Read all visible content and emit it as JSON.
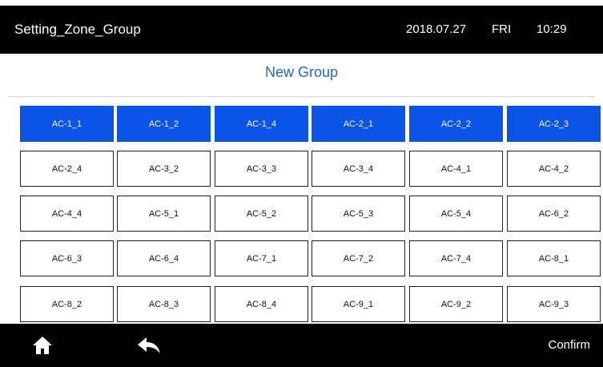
{
  "header": {
    "title": "Setting_Zone_Group",
    "date": "2018.07.27",
    "day": "FRI",
    "time": "10:29"
  },
  "subtitle": "New Group",
  "colors": {
    "selected": "#0a55e8",
    "accent_text": "#1f66e0",
    "bar": "#000000"
  },
  "grid": {
    "rows": [
      [
        {
          "label": "AC-1_1",
          "selected": true
        },
        {
          "label": "AC-1_2",
          "selected": true
        },
        {
          "label": "AC-1_4",
          "selected": true
        },
        {
          "label": "AC-2_1",
          "selected": true
        },
        {
          "label": "AC-2_2",
          "selected": true
        },
        {
          "label": "AC-2_3",
          "selected": true
        }
      ],
      [
        {
          "label": "AC-2_4",
          "selected": false
        },
        {
          "label": "AC-3_2",
          "selected": false
        },
        {
          "label": "AC-3_3",
          "selected": false
        },
        {
          "label": "AC-3_4",
          "selected": false
        },
        {
          "label": "AC-4_1",
          "selected": false
        },
        {
          "label": "AC-4_2",
          "selected": false
        }
      ],
      [
        {
          "label": "AC-4_4",
          "selected": false
        },
        {
          "label": "AC-5_1",
          "selected": false
        },
        {
          "label": "AC-5_2",
          "selected": false
        },
        {
          "label": "AC-5_3",
          "selected": false
        },
        {
          "label": "AC-5_4",
          "selected": false
        },
        {
          "label": "AC-6_2",
          "selected": false
        }
      ],
      [
        {
          "label": "AC-6_3",
          "selected": false
        },
        {
          "label": "AC-6_4",
          "selected": false
        },
        {
          "label": "AC-7_1",
          "selected": false
        },
        {
          "label": "AC-7_2",
          "selected": false
        },
        {
          "label": "AC-7_4",
          "selected": false
        },
        {
          "label": "AC-8_1",
          "selected": false
        }
      ],
      [
        {
          "label": "AC-8_2",
          "selected": false
        },
        {
          "label": "AC-8_3",
          "selected": false
        },
        {
          "label": "AC-8_4",
          "selected": false
        },
        {
          "label": "AC-9_1",
          "selected": false
        },
        {
          "label": "AC-9_2",
          "selected": false
        },
        {
          "label": "AC-9_3",
          "selected": false
        }
      ]
    ]
  },
  "footer": {
    "home_icon": "home-icon",
    "back_icon": "back-arrow-icon",
    "confirm_label": "Confirm"
  }
}
